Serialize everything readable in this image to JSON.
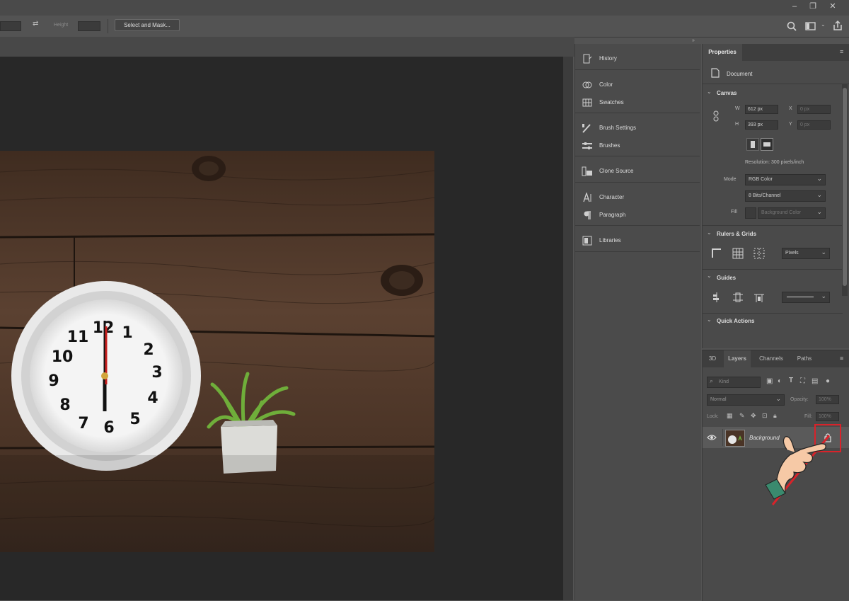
{
  "options_bar": {
    "height_label": "Height",
    "select_mask_button": "Select and Mask..."
  },
  "panels": [
    {
      "label": "History",
      "icon": "history-icon"
    },
    {
      "label": "Color",
      "icon": "color-icon"
    },
    {
      "label": "Swatches",
      "icon": "swatches-icon"
    },
    {
      "label": "Brush Settings",
      "icon": "brush-settings-icon"
    },
    {
      "label": "Brushes",
      "icon": "brushes-icon"
    },
    {
      "label": "Clone Source",
      "icon": "clone-source-icon"
    },
    {
      "label": "Character",
      "icon": "character-icon"
    },
    {
      "label": "Paragraph",
      "icon": "paragraph-icon"
    },
    {
      "label": "Libraries",
      "icon": "libraries-icon"
    }
  ],
  "properties": {
    "tab": "Properties",
    "doc_label": "Document",
    "canvas": {
      "title": "Canvas",
      "w_label": "W",
      "w_value": "612 px",
      "h_label": "H",
      "h_value": "393 px",
      "x_label": "X",
      "x_value": "0 px",
      "y_label": "Y",
      "y_value": "0 px",
      "resolution": "Resolution: 300 pixels/inch",
      "mode_label": "Mode",
      "mode_value": "RGB Color",
      "depth_value": "8 Bits/Channel",
      "fill_label": "Fill",
      "fill_value": "Background Color"
    },
    "rulers": {
      "title": "Rulers & Grids",
      "unit": "Pixels"
    },
    "guides": {
      "title": "Guides"
    },
    "quick_actions": {
      "title": "Quick Actions"
    }
  },
  "layers_panel": {
    "tabs": [
      "3D",
      "Layers",
      "Channels",
      "Paths"
    ],
    "active_tab": "Layers",
    "search_placeholder": "Kind",
    "blend_mode": "Normal",
    "opacity_label": "Opacity:",
    "opacity_value": "100%",
    "lock_label": "Lock:",
    "fill_label": "Fill:",
    "fill_value": "100%",
    "layer_name": "Background"
  },
  "clock_numbers": [
    "12",
    "1",
    "2",
    "3",
    "4",
    "5",
    "6",
    "7",
    "8",
    "9",
    "10",
    "11"
  ],
  "colors": {
    "highlight": "#d8232a",
    "wood": "#4a3426"
  }
}
